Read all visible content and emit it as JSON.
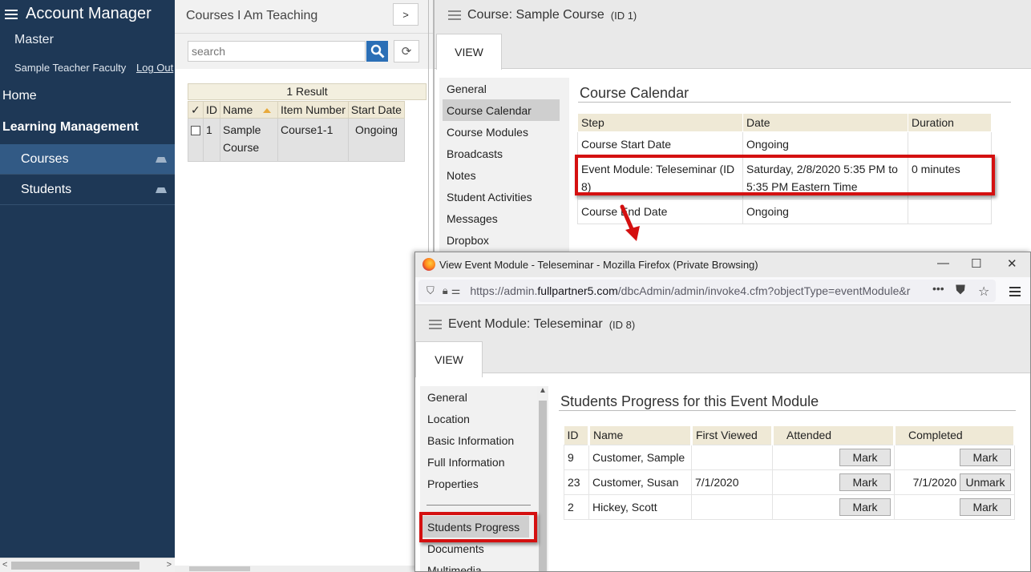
{
  "left_nav": {
    "app_title": "Account Manager",
    "subtitle": "Master",
    "user_name": "Sample Teacher Faculty",
    "logout": "Log Out",
    "home": "Home",
    "section": "Learning Management",
    "items": [
      {
        "label": "Courses",
        "active": true
      },
      {
        "label": "Students",
        "active": false
      }
    ]
  },
  "courses_panel": {
    "title": "Courses I Am Teaching",
    "next": ">",
    "search_placeholder": "search",
    "refresh_icon": "refresh-icon",
    "result_count": "1 Result",
    "columns": [
      "✓",
      "ID",
      "Name",
      "Item Number",
      "Start Date"
    ],
    "rows": [
      {
        "id": "1",
        "name": "Sample Course",
        "item_number": "Course1-1",
        "start_date": "Ongoing"
      }
    ]
  },
  "course_detail": {
    "title": "Course: Sample Course",
    "id_label": "(ID 1)",
    "tab": "VIEW",
    "side_items": [
      "General",
      "Course Calendar",
      "Course Modules",
      "Broadcasts",
      "Notes",
      "Student Activities",
      "Messages",
      "Dropbox"
    ],
    "selected_side": "Course Calendar",
    "calendar": {
      "heading": "Course Calendar",
      "columns": [
        "Step",
        "Date",
        "Duration"
      ],
      "rows": [
        {
          "step": "Course Start Date",
          "date": "Ongoing",
          "duration": ""
        },
        {
          "step": "Event Module: Teleseminar (ID 8)",
          "date": "Saturday, 2/8/2020 5:35 PM to 5:35 PM Eastern Time",
          "duration": "0 minutes"
        },
        {
          "step": "Course End Date",
          "date": "Ongoing",
          "duration": ""
        }
      ]
    }
  },
  "popup": {
    "window_title": "View Event Module - Teleseminar - Mozilla Firefox (Private Browsing)",
    "url_prefix": "https://admin.",
    "url_domain": "fullpartner5.com",
    "url_rest": "/dbcAdmin/admin/invoke4.cfm?objectType=eventModule&r",
    "url_more": "•••",
    "title": "Event Module: Teleseminar",
    "id_label": "(ID 8)",
    "tab": "VIEW",
    "side_items": [
      "General",
      "Location",
      "Basic Information",
      "Full Information",
      "Properties"
    ],
    "side_items_after": [
      "Students Progress",
      "Documents",
      "Multimedia"
    ],
    "selected_side": "Students Progress",
    "progress": {
      "heading": "Students Progress for this Event Module",
      "columns": [
        "ID",
        "Name",
        "First Viewed",
        "Attended",
        "Completed"
      ],
      "rows": [
        {
          "id": "9",
          "name": "Customer, Sample",
          "first_viewed": "",
          "attended_btn": "Mark",
          "completed_date": "",
          "completed_btn": "Mark"
        },
        {
          "id": "23",
          "name": "Customer, Susan",
          "first_viewed": "7/1/2020",
          "attended_btn": "Mark",
          "completed_date": "7/1/2020",
          "completed_btn": "Unmark"
        },
        {
          "id": "2",
          "name": "Hickey, Scott",
          "first_viewed": "",
          "attended_btn": "Mark",
          "completed_date": "",
          "completed_btn": "Mark"
        }
      ]
    }
  },
  "colors": {
    "nav_bg": "#1e3856",
    "nav_active": "#325a85",
    "header_tan": "#efe9d6",
    "highlight_red": "#d41010",
    "search_blue": "#2b6fb6"
  }
}
